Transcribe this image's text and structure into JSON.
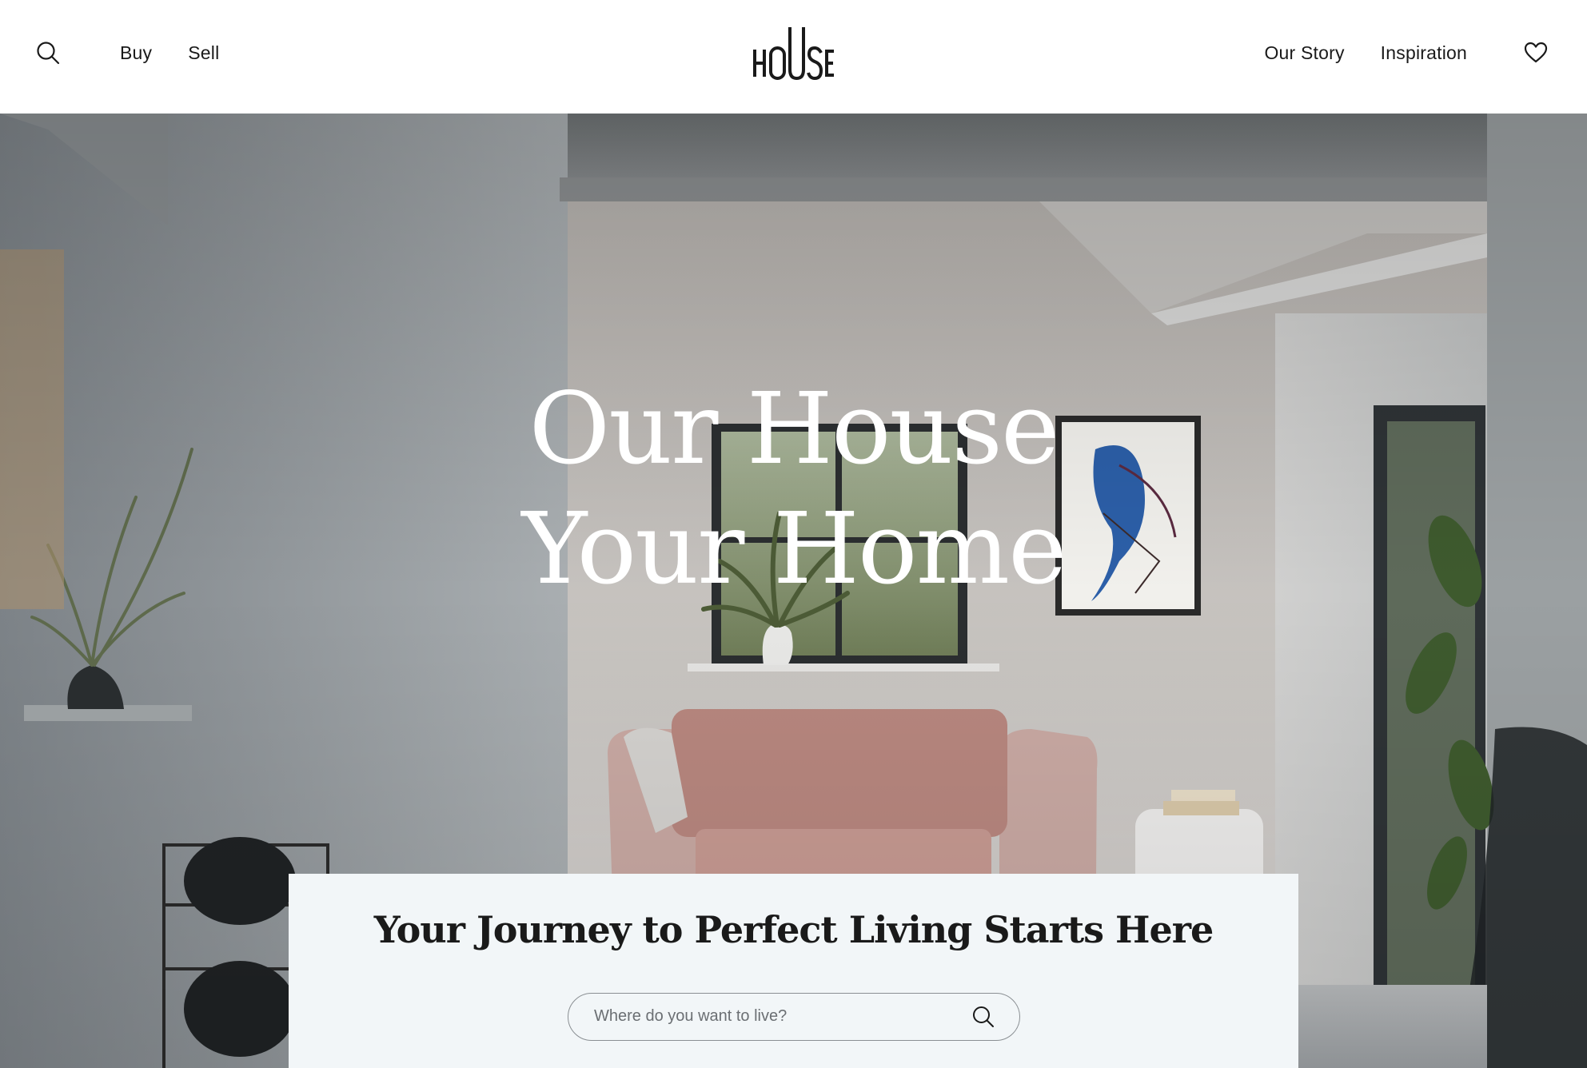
{
  "header": {
    "logo_text": "HOUSE",
    "search_icon": "search-icon",
    "nav_left": [
      {
        "label": "Buy"
      },
      {
        "label": "Sell"
      }
    ],
    "nav_right": [
      {
        "label": "Our Story"
      },
      {
        "label": "Inspiration"
      }
    ],
    "favorites_icon": "heart-icon"
  },
  "hero": {
    "title_line1": "Our House",
    "title_line2": "Your Home"
  },
  "search_panel": {
    "heading": "Your Journey to Perfect Living Starts Here",
    "placeholder": "Where do you want to live?",
    "submit_icon": "search-icon"
  },
  "colors": {
    "text": "#1a1a1a",
    "panel_bg": "#f2f6f8",
    "hero_text": "#ffffff"
  }
}
